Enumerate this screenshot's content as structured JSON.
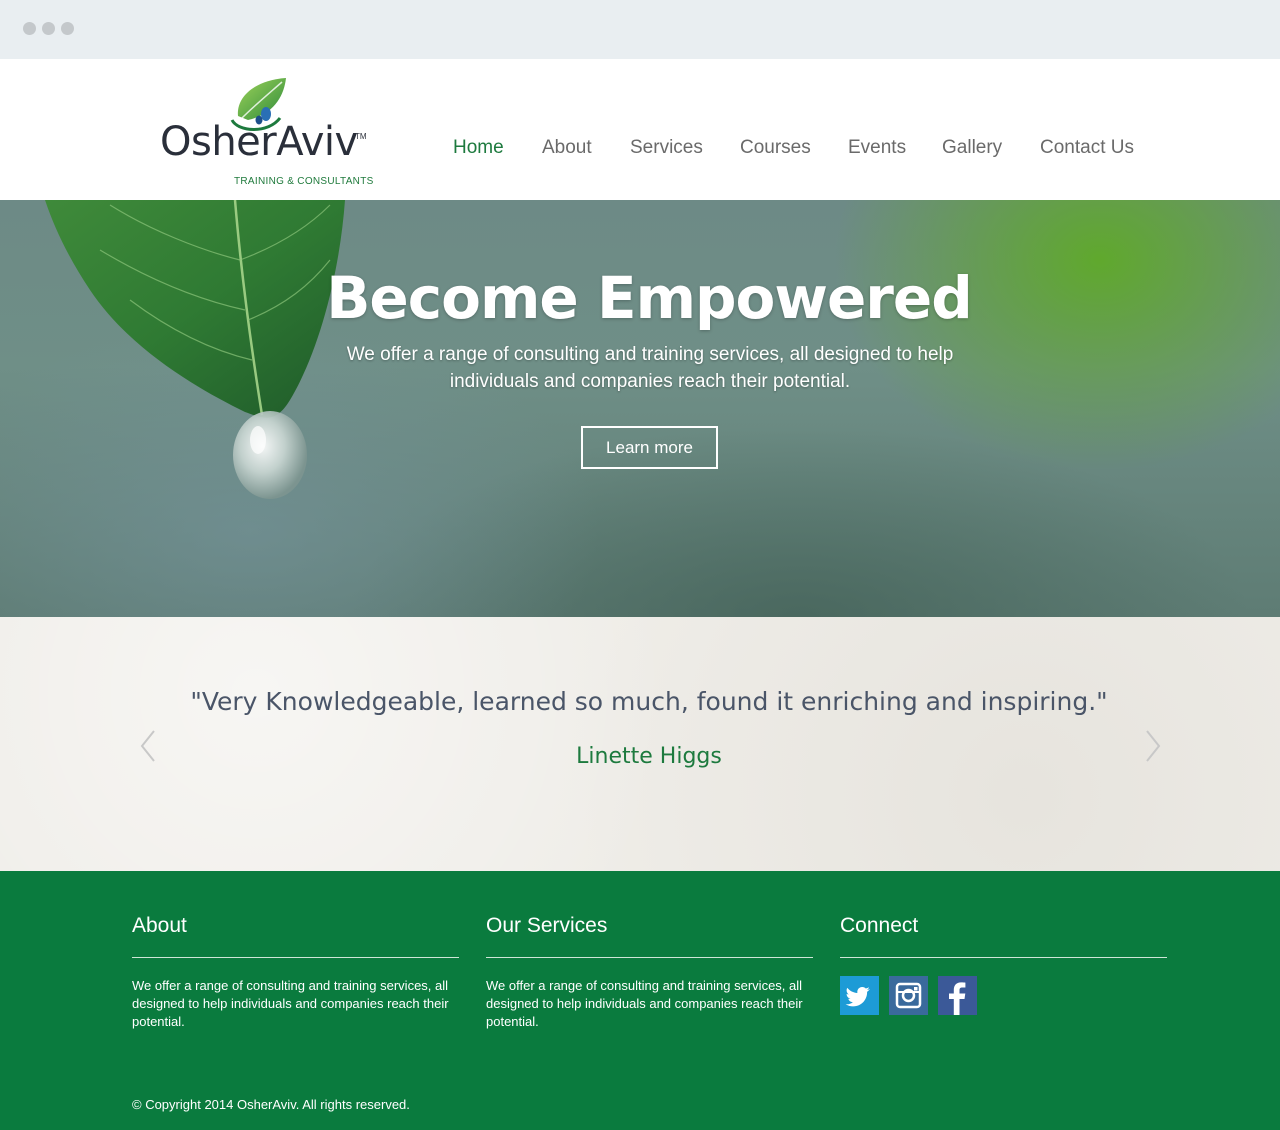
{
  "brand": {
    "name": "OsherAviv",
    "trademark": "TM",
    "tagline": "TRAINING & CONSULTANTS"
  },
  "nav": {
    "items": [
      {
        "label": "Home",
        "active": true
      },
      {
        "label": "About",
        "active": false
      },
      {
        "label": "Services",
        "active": false
      },
      {
        "label": "Courses",
        "active": false
      },
      {
        "label": "Events",
        "active": false
      },
      {
        "label": "Gallery",
        "active": false
      },
      {
        "label": "Contact Us",
        "active": false
      }
    ]
  },
  "hero": {
    "title": "Become Empowered",
    "subtitle": "We offer a range of consulting and training services, all designed to help individuals and companies reach their potential.",
    "button_label": "Learn more"
  },
  "testimonial": {
    "quote": "\"Very Knowledgeable, learned so much, found it enriching and inspiring.\"",
    "author": "Linette Higgs"
  },
  "footer": {
    "about": {
      "heading": "About",
      "text": "We offer a range of consulting and training services, all designed to help individuals and companies reach their potential."
    },
    "services": {
      "heading": "Our Services",
      "text": "We offer a range of consulting and training services, all designed to help individuals and companies reach their potential."
    },
    "connect": {
      "heading": "Connect",
      "social": [
        "twitter-icon",
        "instagram-icon",
        "facebook-icon"
      ]
    },
    "copyright": "© Copyright 2014 OsherAviv. All rights reserved."
  },
  "colors": {
    "brand_green": "#1d7a3e",
    "footer_green": "#0a7b3e",
    "twitter_blue": "#1d9bd6",
    "instagram_blue": "#3a6a9c",
    "facebook_blue": "#3b5998"
  }
}
